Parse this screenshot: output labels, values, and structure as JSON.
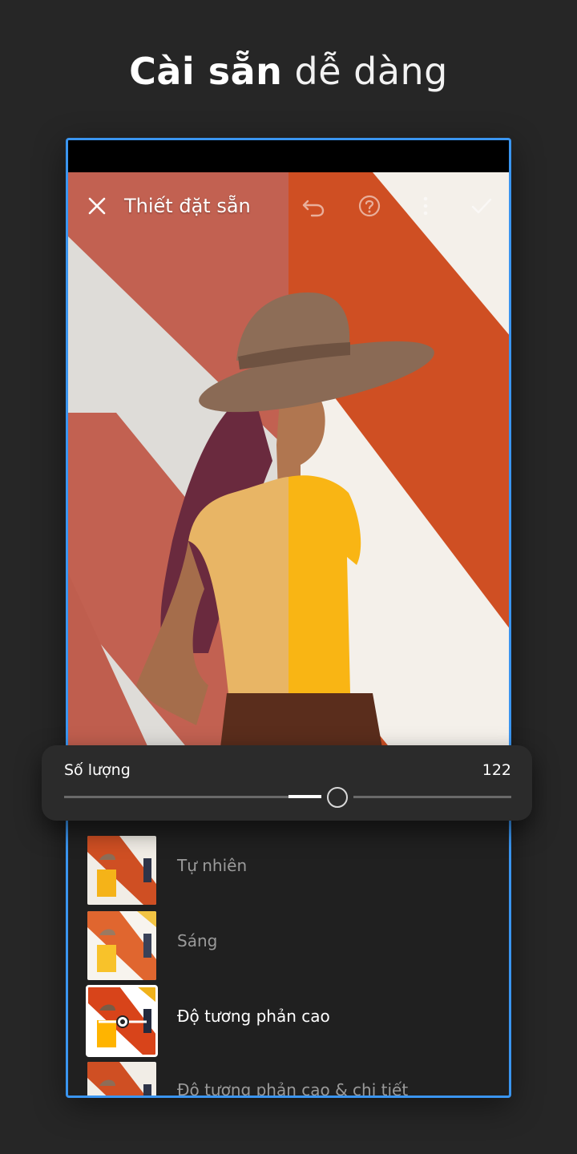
{
  "headline": {
    "bold": "Cài sẵn",
    "light": "dễ dàng"
  },
  "app_bar": {
    "title": "Thiết đặt sẵn",
    "icons": [
      "close-icon",
      "undo-icon",
      "help-icon",
      "more-vert-icon",
      "check-icon"
    ]
  },
  "slider": {
    "label": "Số lượng",
    "value": "122",
    "level_percent": 61
  },
  "presets": [
    {
      "label": "Tự nhiên",
      "selected": false
    },
    {
      "label": "Sáng",
      "selected": false
    },
    {
      "label": "Độ tương phản cao",
      "selected": true
    },
    {
      "label": "Độ tương phản cao & chi tiết",
      "selected": false
    }
  ],
  "colors": {
    "accent": "#3a95f0",
    "background": "#262626",
    "panel": "#202020"
  }
}
